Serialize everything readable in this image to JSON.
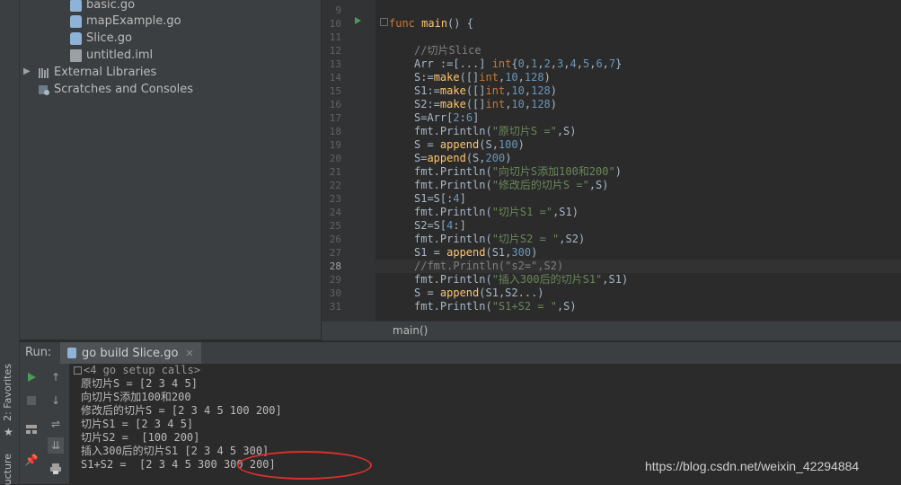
{
  "left_strip": {
    "favorites": "2: Favorites",
    "structure": "ucture"
  },
  "project_tree": [
    {
      "name": "basic.go",
      "type": "go"
    },
    {
      "name": "mapExample.go",
      "type": "go"
    },
    {
      "name": "Slice.go",
      "type": "go"
    },
    {
      "name": "untitled.iml",
      "type": "iml"
    },
    {
      "name": "External Libraries",
      "type": "libs"
    },
    {
      "name": "Scratches and Consoles",
      "type": "scratch"
    }
  ],
  "editor": {
    "line_numbers": [
      "9",
      "10",
      "11",
      "12",
      "13",
      "14",
      "15",
      "16",
      "17",
      "18",
      "19",
      "20",
      "21",
      "22",
      "23",
      "24",
      "25",
      "26",
      "27",
      "28",
      "29",
      "30",
      "31"
    ],
    "current_line": "28",
    "breadcrumb": "main()"
  },
  "run": {
    "label": "Run:",
    "tab": "go build Slice.go",
    "console": [
      "<4 go setup calls>",
      "原切片S = [2 3 4 5]",
      "向切片S添加100和200",
      "修改后的切片S = [2 3 4 5 100 200]",
      "切片S1 = [2 3 4 5]",
      "切片S2 =  [100 200]",
      "插入300后的切片S1 [2 3 4 5 300]",
      "S1+S2 =  [2 3 4 5 300 300 200]"
    ]
  },
  "watermark": "https://blog.csdn.net/weixin_42294884",
  "colors": {
    "keyword": "#cc7832",
    "function": "#ffc66d",
    "number": "#6897bb",
    "string": "#6a8759",
    "comment": "#808080",
    "annotation": "#d9302c"
  }
}
